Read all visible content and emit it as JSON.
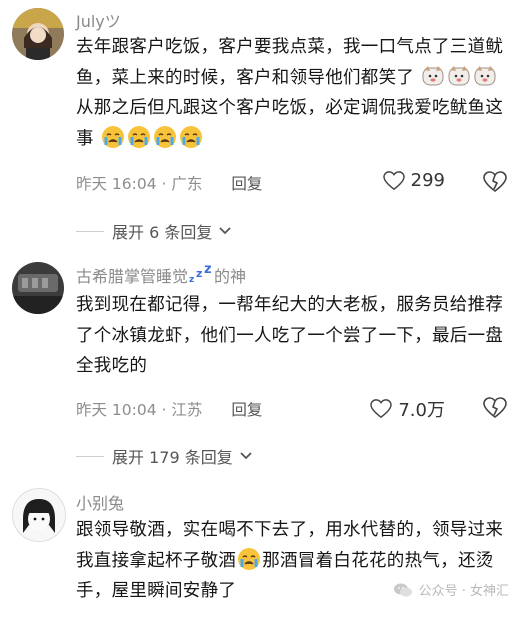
{
  "comments": [
    {
      "username": "Julyツ",
      "text_line1": "去年跟客户吃饭，客户要我点菜，我一口气点了三道鱿鱼，菜上来的时候，客户和领导他们都笑了",
      "text_line2": "从那之后但凡跟这个客户吃饭，必定调侃我爱吃鱿鱼这事",
      "time": "昨天 16:04 · 广东",
      "reply_label": "回复",
      "likes": "299",
      "expand_label": "展开 6 条回复"
    },
    {
      "username": "古希腊掌管睡觉",
      "username_suffix": "的神",
      "text": "我到现在都记得，一帮年纪大的大老板，服务员给推荐了个冰镇龙虾，他们一人吃了一个尝了一下，最后一盘全我吃的",
      "time": "昨天 10:04 · 江苏",
      "reply_label": "回复",
      "likes": "7.0万",
      "expand_label": "展开 179 条回复"
    },
    {
      "username": "小别兔",
      "text_part1": "跟领导敬酒，实在喝不下去了，用水代替的，领导过来我直接拿起杯子敬酒",
      "text_part2": "那酒冒着白花花的热气，还烫手，屋里瞬间安静了"
    }
  ],
  "watermark": "公众号 · 女神汇",
  "colors": {
    "text": "#161616",
    "meta": "#8d8d8d",
    "emoji_cry": "#f7c33a"
  }
}
